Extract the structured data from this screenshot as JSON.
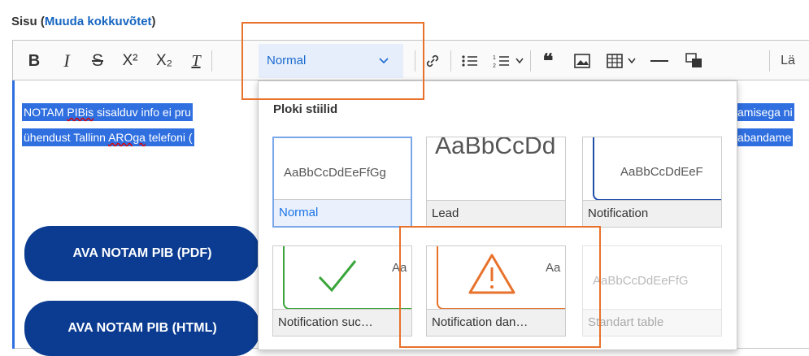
{
  "header": {
    "label": "Sisu",
    "link": "Muuda kokkuvõtet"
  },
  "toolbar": {
    "bold": "B",
    "italic": "I",
    "strike": "S",
    "superscript": "X²",
    "subscript": "X₂",
    "clear": "T",
    "format_value": "Normal",
    "cut_label": "Lä"
  },
  "editor": {
    "line1": "NOTAM PIBis sisalduv info ei pru",
    "line1_end": "amisega ni",
    "line2_pre": "ühendust Tallinn ",
    "line2_sq": "AROga",
    "line2_post": " telefoni (",
    "line2_end": "abandame",
    "squiggle_word": "PIBis",
    "button_pdf": "AVA NOTAM PIB (PDF)",
    "button_html": "AVA NOTAM PIB (HTML)"
  },
  "dropdown": {
    "title": "Ploki stiilid",
    "styles": [
      {
        "label": "Normal",
        "preview": "AaBbCcDdEeFfGg"
      },
      {
        "label": "Lead",
        "preview": "AaBbCcDd"
      },
      {
        "label": "Notification",
        "preview": "AaBbCcDdEeF"
      },
      {
        "label": "Notification suc…",
        "preview": "Aa"
      },
      {
        "label": "Notification dan…",
        "preview": "Aa"
      },
      {
        "label": "Standart table",
        "preview": "AaBbCcDdEeFfG"
      }
    ]
  },
  "colors": {
    "accent": "#2f6fe0",
    "brand": "#0b3c91",
    "highlight_box": "#e8722c",
    "success": "#3aa53a",
    "danger": "#e8722c"
  }
}
